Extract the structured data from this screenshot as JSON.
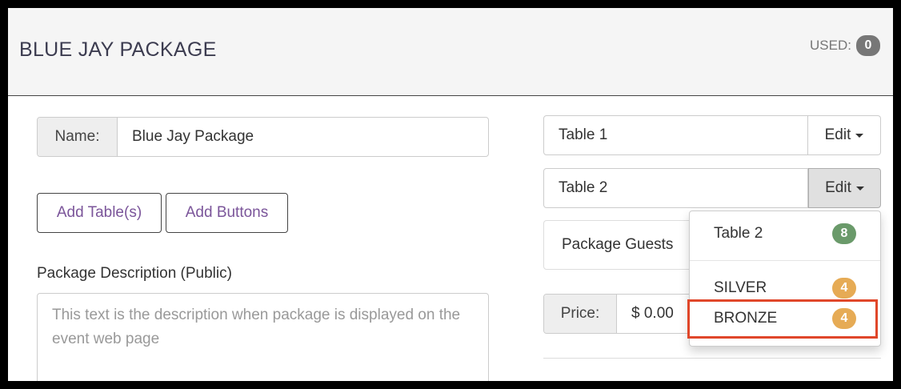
{
  "header": {
    "title": "BLUE JAY PACKAGE",
    "used_label": "USED:",
    "used_count": "0"
  },
  "form": {
    "name_label": "Name:",
    "name_value": "Blue Jay Package",
    "add_tables_label": "Add Table(s)",
    "add_buttons_label": "Add Buttons",
    "description_label": "Package Description (Public)",
    "description_placeholder": "This text is the description when package is displayed on the event web page"
  },
  "tables": [
    {
      "name": "Table 1",
      "edit_label": "Edit"
    },
    {
      "name": "Table 2",
      "edit_label": "Edit"
    }
  ],
  "guests_label": "Package Guests",
  "price": {
    "label": "Price:",
    "value": "$ 0.00"
  },
  "dropdown": {
    "items": [
      {
        "label": "Table 2",
        "count": "8",
        "color": "#6a9a6a"
      },
      {
        "label": "SILVER",
        "count": "4",
        "color": "#e6ab55"
      },
      {
        "label": "BRONZE",
        "count": "4",
        "color": "#e6ab55"
      }
    ],
    "highlight_color": "#e0472a"
  }
}
